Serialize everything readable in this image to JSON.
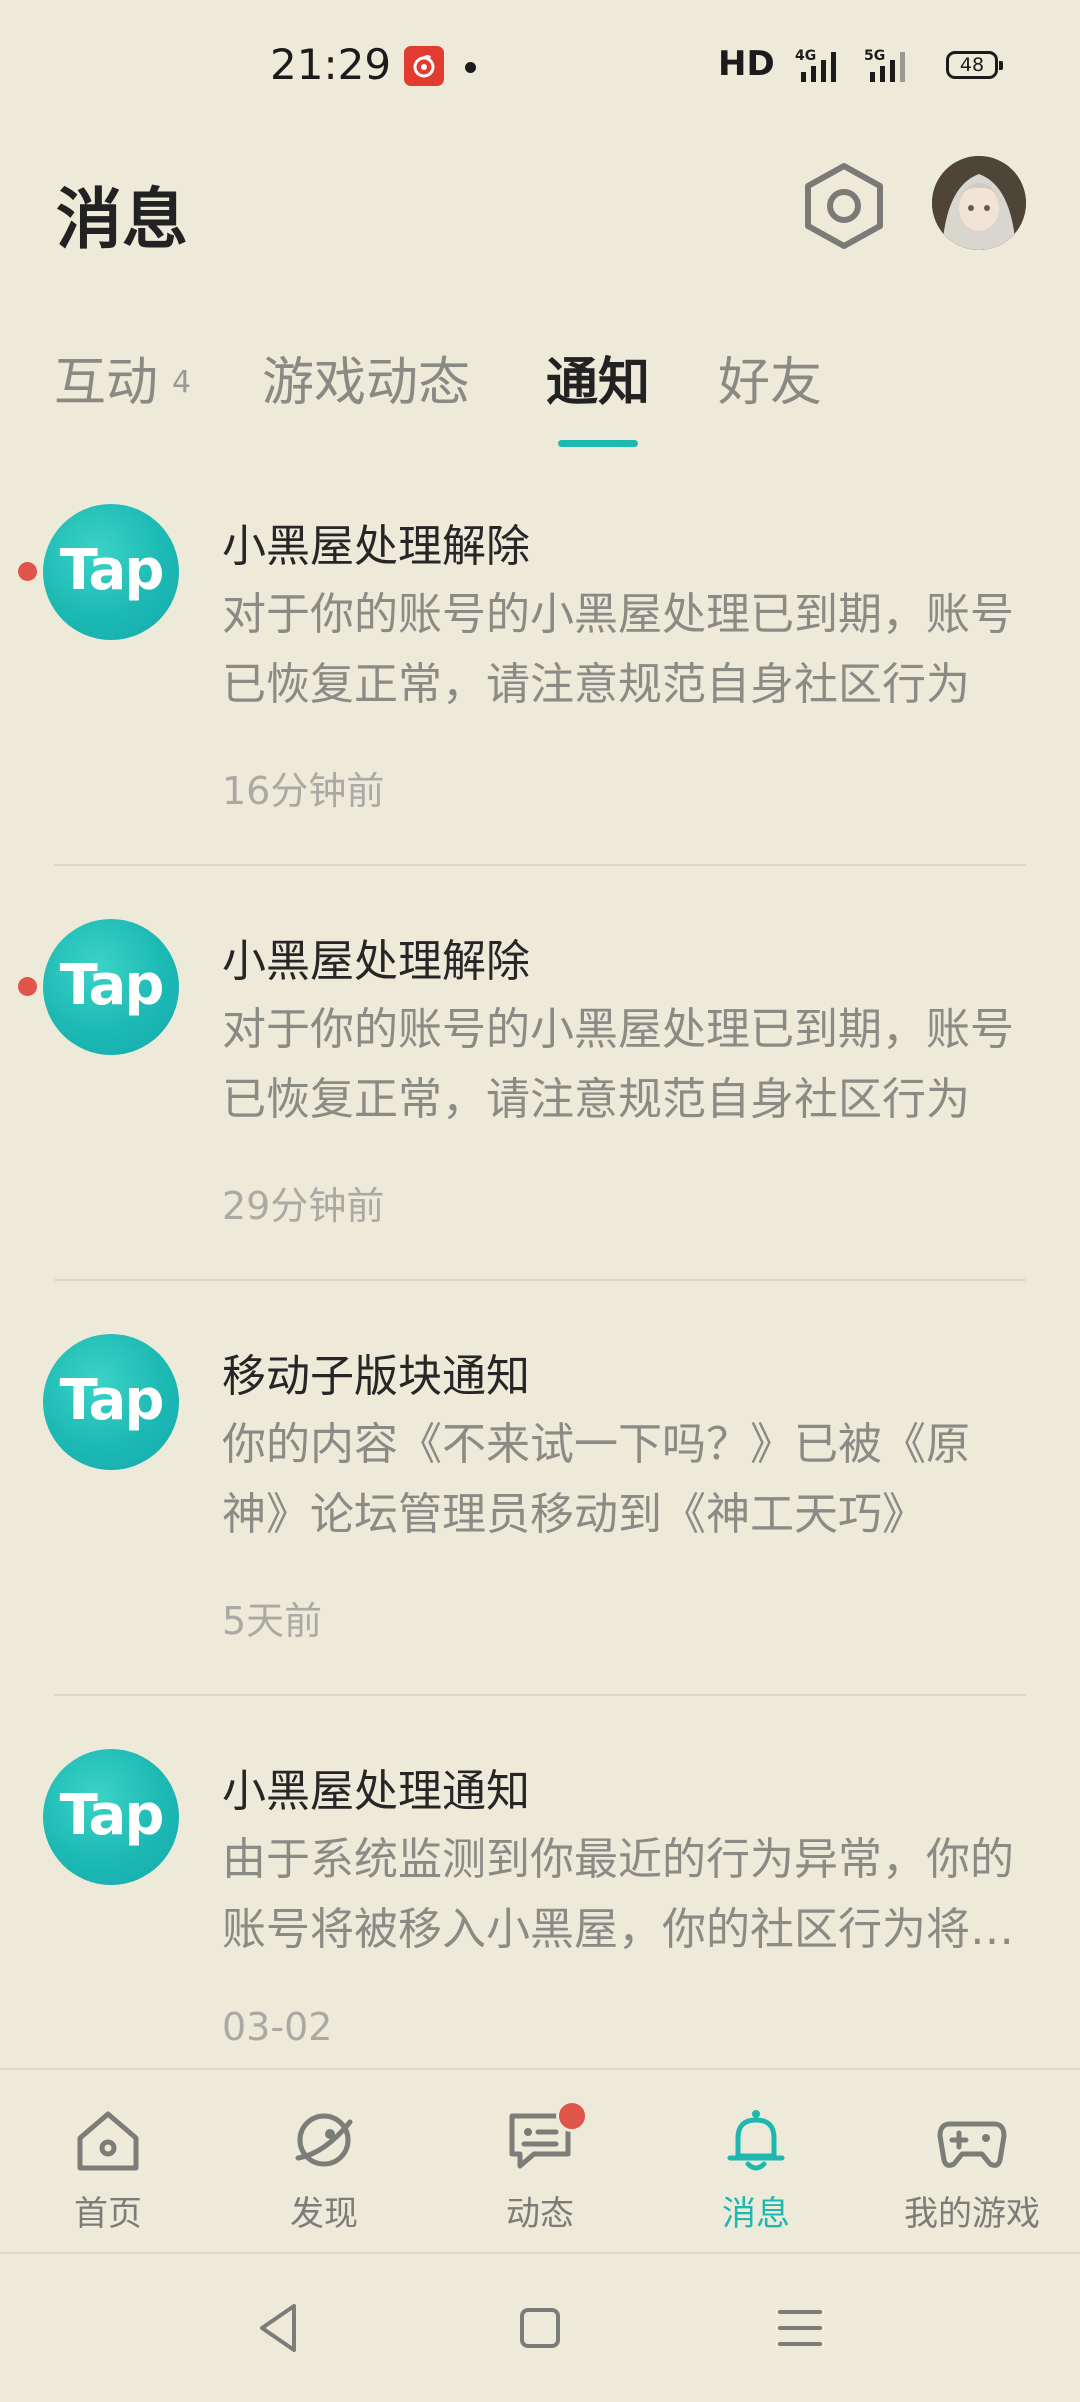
{
  "status_bar": {
    "time": "21:29",
    "network": "HD",
    "signal_1": "4G",
    "signal_2": "5G",
    "battery": "48"
  },
  "header": {
    "title": "消息",
    "icons": [
      "settings-hex-icon",
      "avatar"
    ]
  },
  "tabs": [
    {
      "label": "互动",
      "count": "4"
    },
    {
      "label": "游戏动态"
    },
    {
      "label": "通知",
      "active": true
    },
    {
      "label": "好友"
    }
  ],
  "notifications": [
    {
      "logo": "Tap",
      "title": "小黑屋处理解除",
      "body": "对于你的账号的小黑屋处理已到期，账号已恢复正常，请注意规范自身社区行为",
      "time": "16分钟前",
      "unread": true
    },
    {
      "logo": "Tap",
      "title": "小黑屋处理解除",
      "body": "对于你的账号的小黑屋处理已到期，账号已恢复正常，请注意规范自身社区行为",
      "time": "29分钟前",
      "unread": true
    },
    {
      "logo": "Tap",
      "title": "移动子版块通知",
      "body": "你的内容《不来试一下吗？》已被《原神》论坛管理员移动到《神工天巧》",
      "time": "5天前",
      "unread": false
    },
    {
      "logo": "Tap",
      "title": "小黑屋处理通知",
      "body": "由于系统监测到你最近的行为异常，你的账号将被移入小黑屋，你的社区行为将受到限制",
      "time": "03-02",
      "unread": false
    }
  ],
  "bottom_nav": [
    {
      "label": "首页",
      "icon": "home-icon"
    },
    {
      "label": "发现",
      "icon": "discover-icon"
    },
    {
      "label": "动态",
      "icon": "feed-icon",
      "badge": true
    },
    {
      "label": "消息",
      "icon": "bell-icon",
      "active": true
    },
    {
      "label": "我的游戏",
      "icon": "gamepad-icon"
    }
  ],
  "colors": {
    "background": "#eeead9",
    "accent": "#1fb8b0",
    "unread": "#e0554a",
    "logo": "#1cb9b4"
  }
}
